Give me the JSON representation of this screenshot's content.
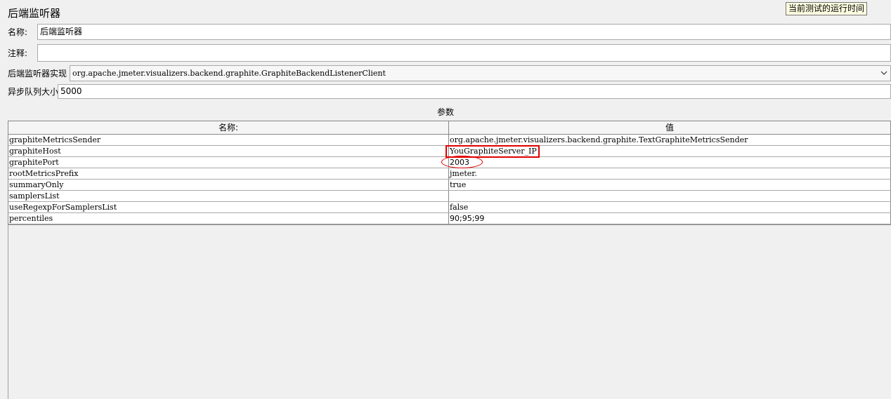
{
  "window": {
    "title": "后端监听器"
  },
  "tooltip": {
    "text": "当前测试的运行时间"
  },
  "form": {
    "name_label": "名称:",
    "name_value": "后端监听器",
    "comment_label": "注释:",
    "comment_value": "",
    "impl_label": "后端监听器实现",
    "impl_value": "org.apache.jmeter.visualizers.backend.graphite.GraphiteBackendListenerClient",
    "queue_label": "异步队列大小",
    "queue_value": "5000"
  },
  "params": {
    "section_title": "参数",
    "columns": [
      "名称:",
      "值"
    ],
    "rows": [
      {
        "name": "graphiteMetricsSender",
        "value": "org.apache.jmeter.visualizers.backend.graphite.TextGraphiteMetricsSender"
      },
      {
        "name": "graphiteHost",
        "value": "YouGraphiteServer_IP"
      },
      {
        "name": "graphitePort",
        "value": "2003"
      },
      {
        "name": "rootMetricsPrefix",
        "value": "jmeter."
      },
      {
        "name": "summaryOnly",
        "value": "true"
      },
      {
        "name": "samplersList",
        "value": ""
      },
      {
        "name": "useRegexpForSamplersList",
        "value": "false"
      },
      {
        "name": "percentiles",
        "value": "90;95;99"
      }
    ]
  },
  "icons": {
    "dropdown": "chevron-down-icon"
  },
  "colors": {
    "highlight": "#e00000",
    "tooltip_bg": "#ffffe1"
  }
}
